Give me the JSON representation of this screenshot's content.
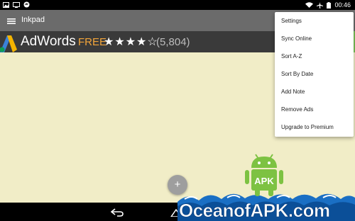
{
  "status_bar": {
    "time": "00:46",
    "left_icons": [
      "image-icon",
      "screen-icon",
      "notification-icon"
    ],
    "right_icons": [
      "wifi-icon",
      "airplane-icon",
      "battery-icon"
    ]
  },
  "app_bar": {
    "title": "Inkpad",
    "menu_icon": "hamburger-menu-icon"
  },
  "ad": {
    "app_name": "AdWords",
    "price": "FREE",
    "stars": "★★★★☆",
    "rating_value": 4.5,
    "reviews": "(5,804)"
  },
  "fab": {
    "label": "+"
  },
  "overflow_menu": {
    "items": [
      {
        "label": "Settings"
      },
      {
        "label": "Sync Online"
      },
      {
        "label": "Sort A-Z"
      },
      {
        "label": "Sort By Date"
      },
      {
        "label": "Add Note"
      },
      {
        "label": "Remove Ads"
      },
      {
        "label": "Upgrade to Premium"
      }
    ]
  },
  "watermark": {
    "text": "OceanofAPK.com",
    "badge": "APK"
  },
  "colors": {
    "content_background": "#f1edc7",
    "app_bar": "#6b6b6b",
    "ad_banner": "#3a3a3a",
    "ad_free": "#f2a53a"
  }
}
